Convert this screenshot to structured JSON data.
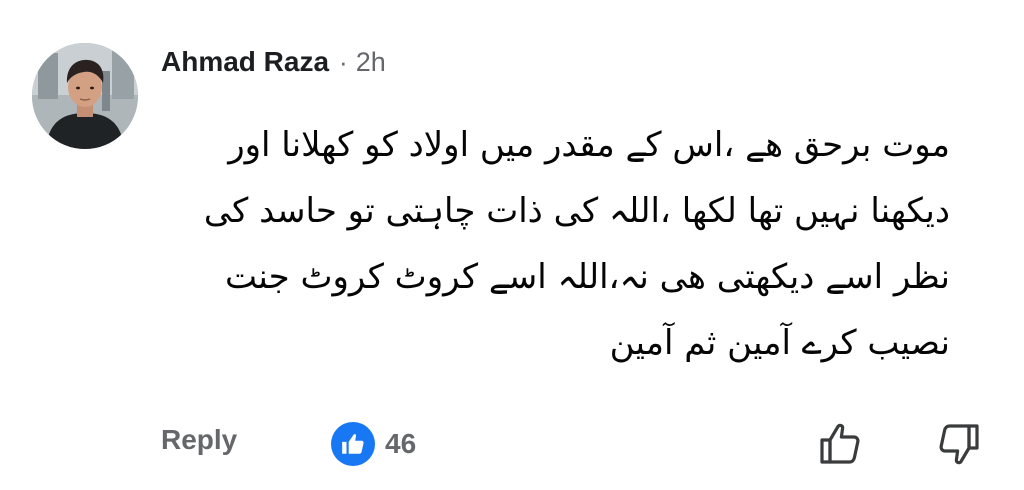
{
  "comment": {
    "author": "Ahmad Raza",
    "separator": "·",
    "time": "2h",
    "lines": [
      "موت برحق ھے ،اس کے مقدر میں اولاد کو کھلانا اور",
      "دیکھنا نہیں تھا لکھا ،اللہ کی ذات چاہتی تو حاسد کی",
      "نظر اسے دیکھتی ھی نہ،اللہ اسے کروٹ کروٹ جنت",
      "نصیب کرے آمین ثم آمین"
    ]
  },
  "actions": {
    "reply_label": "Reply",
    "reaction_count": "46",
    "reaction_icon": "like-icon",
    "like_icon": "thumbs-up-icon",
    "dislike_icon": "thumbs-down-icon"
  },
  "colors": {
    "accent": "#1877f2",
    "text": "#050505",
    "muted": "#65676b"
  }
}
